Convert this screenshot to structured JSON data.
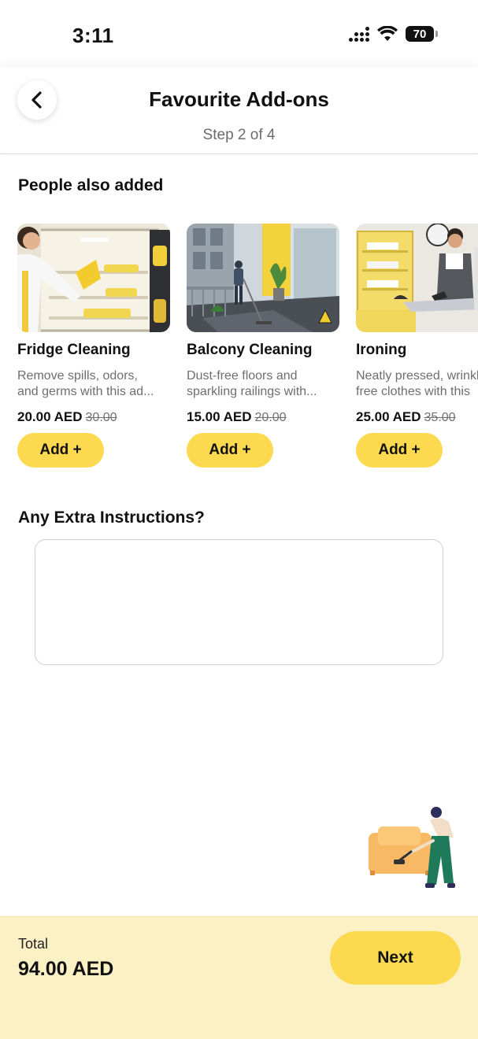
{
  "status_bar": {
    "time": "3:11",
    "battery": "70"
  },
  "header": {
    "title": "Favourite Add-ons",
    "step": "Step 2 of 4"
  },
  "addons_section": {
    "heading": "People also added",
    "items": [
      {
        "name": "Fridge Cleaning",
        "desc_line1": "Remove spills, odors,",
        "desc_line2": "and germs with this ad...",
        "price": "20.00 AED",
        "old_price": "30.00",
        "button": "Add +"
      },
      {
        "name": "Balcony Cleaning",
        "desc_line1": "Dust-free floors and",
        "desc_line2": "sparkling railings with...",
        "price": "15.00 AED",
        "old_price": "20.00",
        "button": "Add +"
      },
      {
        "name": "Ironing",
        "desc_line1": "Neatly pressed, wrinkle-",
        "desc_line2": "free clothes with this",
        "price": "25.00 AED",
        "old_price": "35.00",
        "button": "Add +"
      }
    ]
  },
  "instructions": {
    "heading": "Any Extra Instructions?",
    "placeholder": ""
  },
  "footer": {
    "total_label": "Total",
    "total_value": "94.00 AED",
    "next_label": "Next"
  },
  "colors": {
    "accent": "#fcd94f",
    "footer_bg": "#fcf0c5",
    "muted_text": "#6e6e6e"
  },
  "icons": [
    "back-chevron-icon",
    "signal-icon",
    "wifi-icon",
    "battery-icon"
  ]
}
